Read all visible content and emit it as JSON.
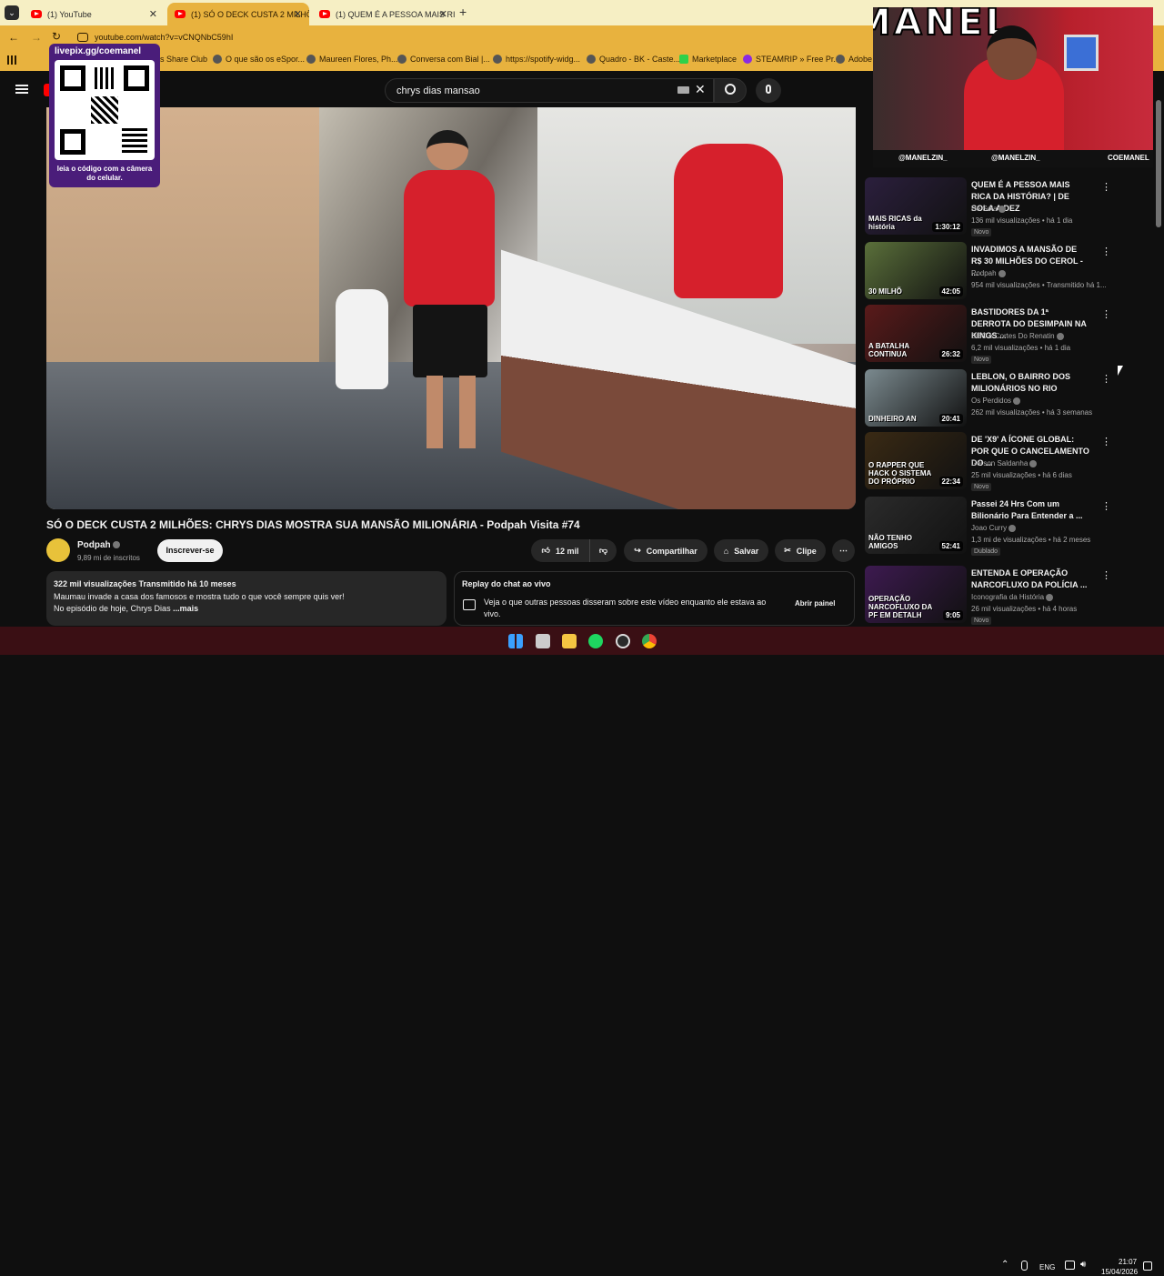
{
  "tabs": [
    {
      "label": "(1) YouTube"
    },
    {
      "label": "(1) SÓ O DECK CUSTA 2 MILHÕ"
    },
    {
      "label": "(1) QUEM É A PESSOA MAIS RI"
    }
  ],
  "address": {
    "url": "youtube.com/watch?v=vCNQNbC59hI"
  },
  "bookmarks": [
    {
      "label": "s Share Club"
    },
    {
      "label": "O que são os eSpor..."
    },
    {
      "label": "Maureen Flores, Ph..."
    },
    {
      "label": "Conversa com Bial |..."
    },
    {
      "label": "https://spotify-widg..."
    },
    {
      "label": "Quadro - BK - Caste..."
    },
    {
      "label": "Marketplace"
    },
    {
      "label": "STEAMRIP » Free Pr..."
    },
    {
      "label": "Adobe A"
    }
  ],
  "overlay": {
    "qr_url": "livepix.gg/coemanel",
    "qr_caption": "leia o código com a câmera do celular.",
    "webcam_banner": "MANEL",
    "handles": [
      "@MANELZIN_",
      "@MANELZIN_",
      "COEMANEL"
    ]
  },
  "search": {
    "query": "chrys dias mansao"
  },
  "video": {
    "title": "SÓ O DECK CUSTA 2 MILHÕES: CHRYS DIAS MOSTRA SUA MANSÃO MILIONÁRIA - Podpah Visita #74",
    "channel": "Podpah",
    "subscribers": "9,89 mi de inscritos",
    "subscribe_label": "Inscrever-se",
    "likes": "12 mil",
    "share_label": "Compartilhar",
    "save_label": "Salvar",
    "clip_label": "Clipe"
  },
  "description": {
    "stats": "322 mil visualizações  Transmitido há 10 meses",
    "line1": "Maumau invade a casa dos famosos e mostra tudo o que você sempre quis ver!",
    "line2": "No episódio de hoje, Chrys Dias",
    "more": "...mais"
  },
  "chat": {
    "title": "Replay do chat ao vivo",
    "text": "Veja o que outras pessoas disseram sobre este vídeo enquanto ele estava ao vivo.",
    "button": "Abrir painel"
  },
  "recommendations": [
    {
      "title": "QUEM É A PESSOA MAIS RICA DA HISTÓRIA? | DE SOLA A DEZ",
      "channel": "De Sola",
      "meta": "136 mil visualizações • há 1 dia",
      "duration": "1:30:12",
      "badge": "Novo",
      "thumb_text": "MAIS RICAS da história",
      "thumb_color": "#2b1f3d"
    },
    {
      "title": "INVADIMOS A MANSÃO DE R$ 30 MILHÕES DO CEROL - ...",
      "channel": "Podpah",
      "meta": "954 mil visualizações • Transmitido há 1...",
      "duration": "42:05",
      "badge": "",
      "thumb_text": "30 MILHÕ",
      "thumb_color": "#5a6f3a"
    },
    {
      "title": "BASTIDORES DA 1ª DERROTA DO DESIMPAIN NA KINGS ...",
      "channel": "DEC e Cortes Do Renatin",
      "meta": "6,2 mil visualizações • há 1 dia",
      "duration": "26:32",
      "badge": "Novo",
      "thumb_text": "A BATALHA CONTINUA",
      "thumb_color": "#5a1a1a"
    },
    {
      "title": "LEBLON, O BAIRRO DOS MILIONÁRIOS NO RIO",
      "channel": "Os Perdidos",
      "meta": "262 mil visualizações • há 3 semanas",
      "duration": "20:41",
      "badge": "",
      "thumb_text": "DINHEIRO AN",
      "thumb_color": "#7b8a8f"
    },
    {
      "title": "DE 'X9' A ÍCONE GLOBAL: POR QUE O CANCELAMENTO DO ...",
      "channel": "Gerson Saldanha",
      "meta": "25 mil visualizações • há 6 dias",
      "duration": "22:34",
      "badge": "Novo",
      "thumb_text": "O RAPPER QUE HACK O SISTEMA DO PRÓPRIO",
      "thumb_color": "#3a2a14"
    },
    {
      "title": "Passei 24 Hrs Com um Bilionário Para Entender a ...",
      "channel": "Joao Curry",
      "meta": "1,3 mi de visualizações • há 2 meses",
      "duration": "52:41",
      "badge": "Dublado",
      "thumb_text": "NÃO TENHO AMIGOS",
      "thumb_color": "#2b2b2b"
    },
    {
      "title": "ENTENDA E OPERAÇÃO NARCOFLUXO DA POLÍCIA ...",
      "channel": "Iconografia da História",
      "meta": "26 mil visualizações • há 4 horas",
      "duration": "9:05",
      "badge": "Novo",
      "thumb_text": "OPERAÇÃO NARCOFLUXO DA PF EM DETALH",
      "thumb_color": "#3d1a50"
    }
  ],
  "taskbar": {
    "lang": "ENG",
    "time": "21:07",
    "date": "15/04/2026"
  },
  "colors": {
    "accent": "#ff0000",
    "tabbar": "#f6efc4",
    "addressbar": "#e8b23e",
    "background": "#0f0f0f",
    "taskbar": "#3a0f14",
    "overlay_purple": "#4a1d7a"
  }
}
